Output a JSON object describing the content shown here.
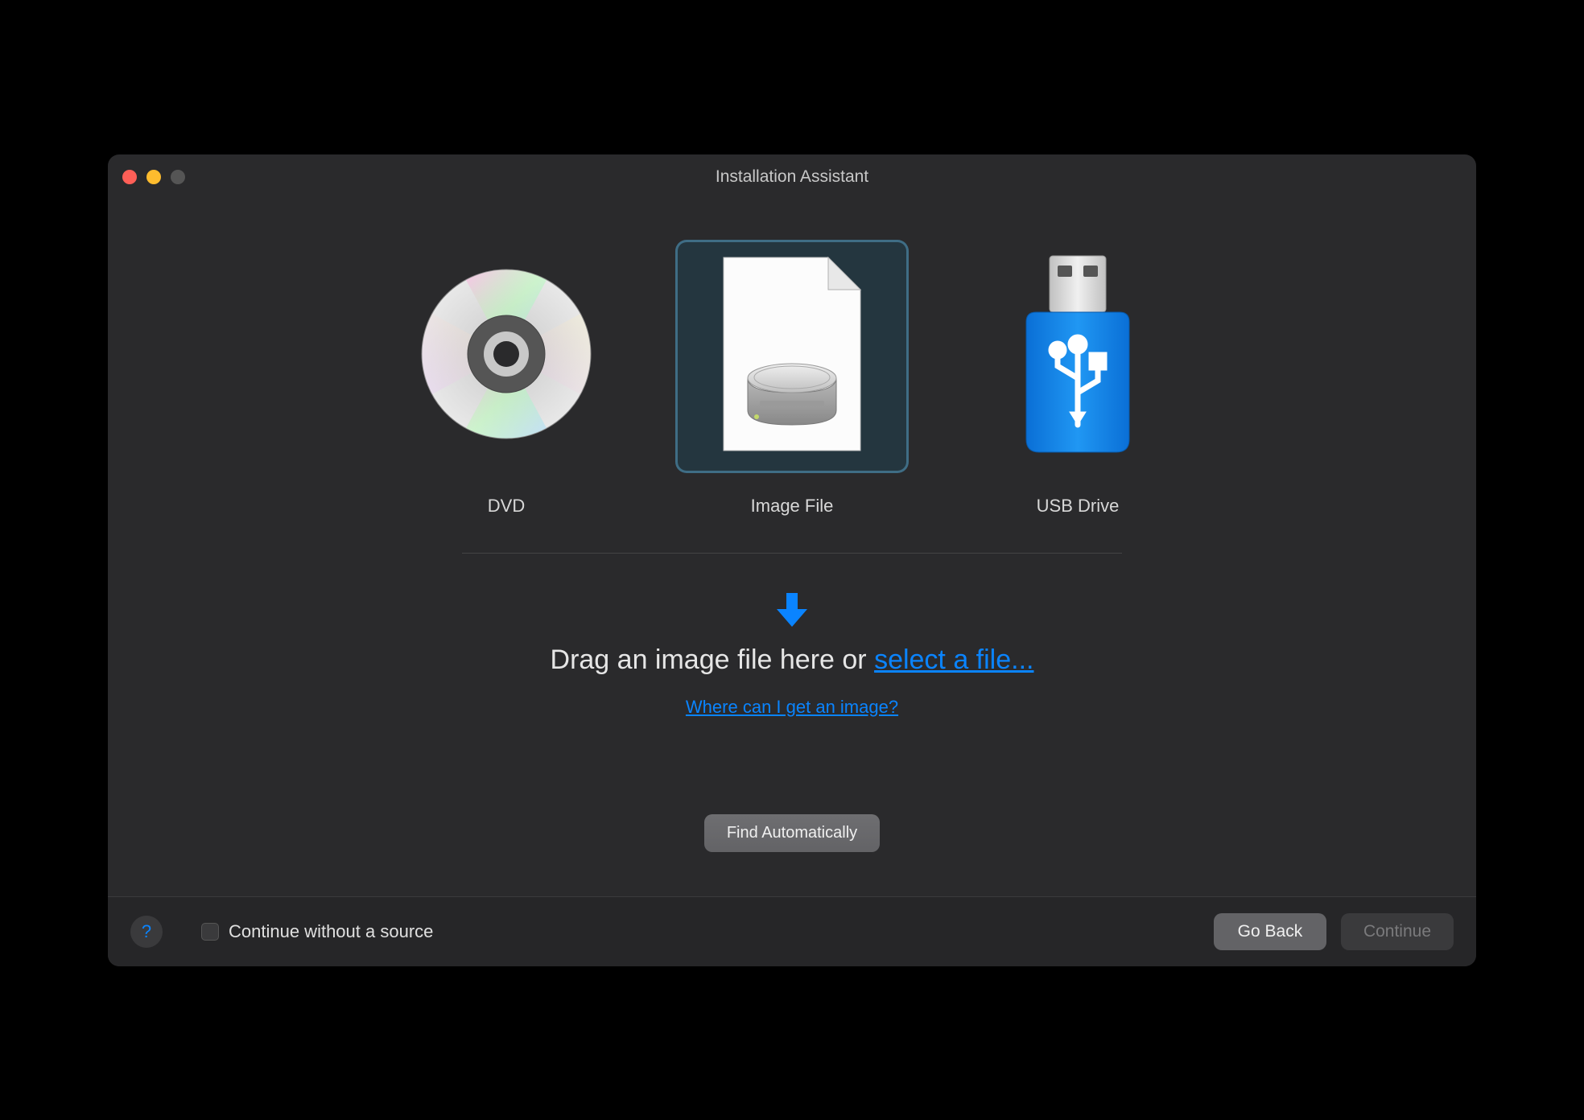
{
  "window": {
    "title": "Installation Assistant"
  },
  "sources": {
    "dvd": {
      "label": "DVD"
    },
    "image": {
      "label": "Image File"
    },
    "usb": {
      "label": "USB Drive"
    }
  },
  "dropzone": {
    "text_prefix": "Drag an image file here or ",
    "select_link": "select a file...",
    "help_link": "Where can I get an image?"
  },
  "buttons": {
    "find_auto": "Find Automatically",
    "go_back": "Go Back",
    "continue": "Continue"
  },
  "footer": {
    "help_char": "?",
    "continue_without": "Continue without a source"
  }
}
